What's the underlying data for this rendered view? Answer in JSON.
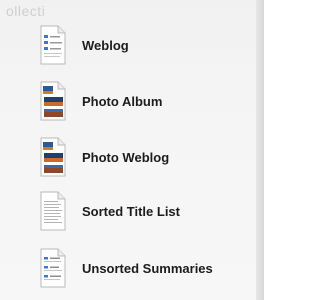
{
  "background_text": "ollecti",
  "items": [
    {
      "label": "Weblog",
      "icon": "weblog-doc-icon"
    },
    {
      "label": "Photo Album",
      "icon": "photo-album-doc-icon"
    },
    {
      "label": "Photo Weblog",
      "icon": "photo-weblog-doc-icon"
    },
    {
      "label": "Sorted Title List",
      "icon": "sorted-list-doc-icon"
    },
    {
      "label": "Unsorted Summaries",
      "icon": "unsorted-summaries-doc-icon"
    }
  ],
  "colors": {
    "text": "#1c1c1c",
    "background": "#f4f4f4"
  }
}
